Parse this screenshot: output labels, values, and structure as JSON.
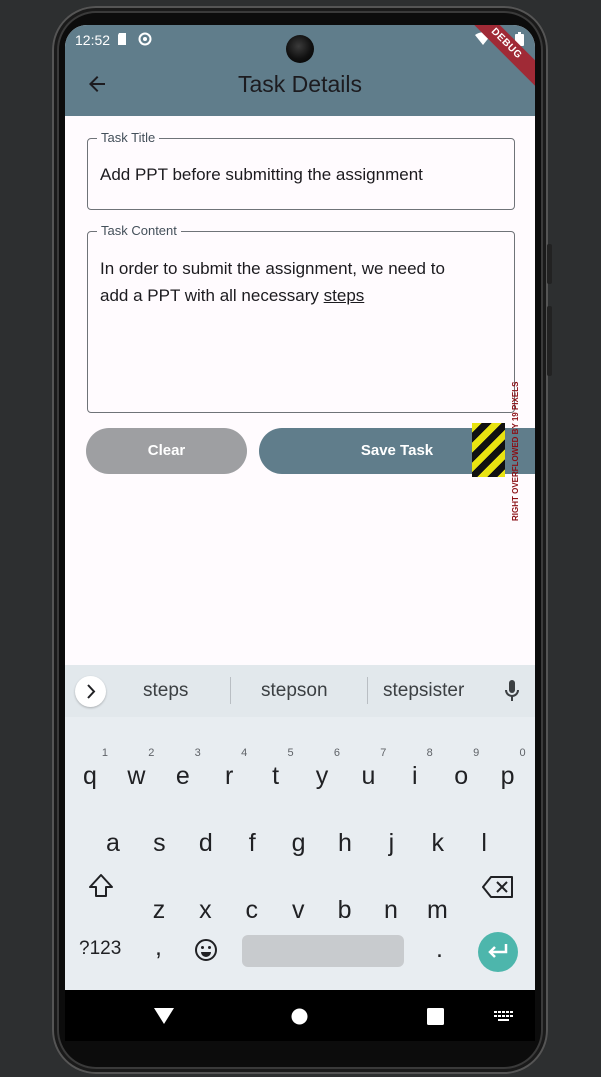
{
  "status_bar": {
    "time": "12:52"
  },
  "app_bar": {
    "title": "Task Details",
    "debug_label": "DEBUG"
  },
  "form": {
    "title_label": "Task Title",
    "title_value": "Add PPT before submitting the assignment",
    "content_label": "Task Content",
    "content_value_line1": "In order to submit the assignment, we need to",
    "content_value_line2_prefix": "add a PPT with all necessary ",
    "content_value_line2_underlined": "steps"
  },
  "buttons": {
    "clear_label": "Clear",
    "save_label": "Save Task"
  },
  "overflow_warning": "RIGHT OVERFLOWED BY 19 PIXELS",
  "keyboard": {
    "suggestions": [
      "steps",
      "stepson",
      "stepsister"
    ],
    "row1": [
      {
        "key": "q",
        "hint": "1"
      },
      {
        "key": "w",
        "hint": "2"
      },
      {
        "key": "e",
        "hint": "3"
      },
      {
        "key": "r",
        "hint": "4"
      },
      {
        "key": "t",
        "hint": "5"
      },
      {
        "key": "y",
        "hint": "6"
      },
      {
        "key": "u",
        "hint": "7"
      },
      {
        "key": "i",
        "hint": "8"
      },
      {
        "key": "o",
        "hint": "9"
      },
      {
        "key": "p",
        "hint": "0"
      }
    ],
    "row2": [
      "a",
      "s",
      "d",
      "f",
      "g",
      "h",
      "j",
      "k",
      "l"
    ],
    "row3": [
      "z",
      "x",
      "c",
      "v",
      "b",
      "n",
      "m"
    ],
    "symbols_label": "?123",
    "comma": ",",
    "period": "."
  },
  "icons": {
    "back": "arrow-back-icon",
    "shift": "shift-icon",
    "backspace": "backspace-icon",
    "emoji": "emoji-icon",
    "enter": "enter-icon",
    "mic": "mic-icon",
    "chevron": "chevron-right-icon",
    "nav_back": "nav-back-icon",
    "nav_home": "nav-home-icon",
    "nav_recents": "nav-recents-icon",
    "nav_keyboard": "keyboard-switch-icon"
  },
  "colors": {
    "primary": "#607d8b",
    "clear_button": "#9e9fa2",
    "enter_key": "#4db6ac",
    "debug_ribbon": "#a02a36"
  }
}
